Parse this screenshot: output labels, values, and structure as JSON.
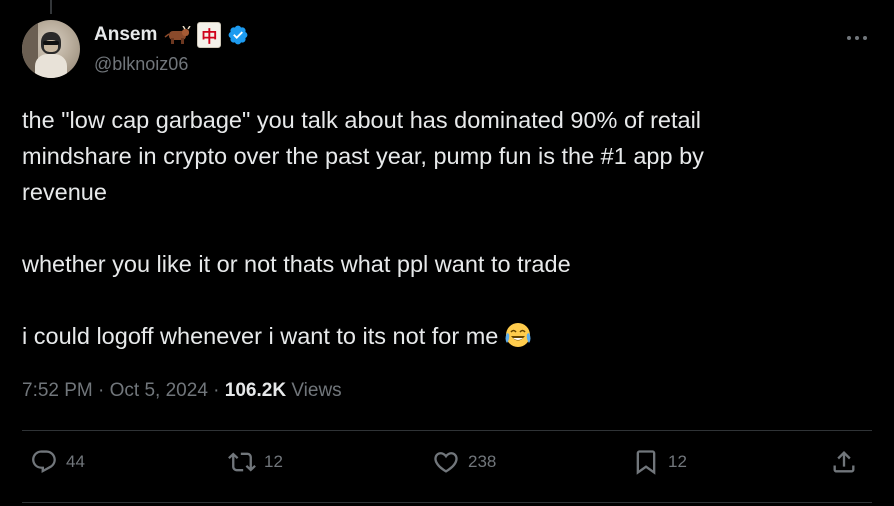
{
  "author": {
    "display_name": "Ansem",
    "handle": "@blknoiz06",
    "name_emojis": [
      "ox-emoji",
      "mahjong-red-dragon"
    ],
    "mahjong_glyph": "中",
    "verified": true
  },
  "tweet": {
    "text_line_1": "the \"low cap garbage\" you talk about has dominated 90% of retail",
    "text_line_2": "mindshare in crypto over the past year, pump fun is the #1 app by",
    "text_line_3": "revenue",
    "text_line_4": "whether you like it or not thats what ppl want to trade",
    "text_line_5": "i could logoff whenever i want to its not for me"
  },
  "meta": {
    "time": "7:52 PM",
    "separator": " · ",
    "date": "Oct 5, 2024",
    "views_count": "106.2K",
    "views_label": " Views"
  },
  "actions": {
    "replies": "44",
    "reposts": "12",
    "likes": "238",
    "bookmarks": "12"
  },
  "colors": {
    "background": "#000000",
    "text_primary": "#e7e9ea",
    "text_secondary": "#71767b",
    "verified_blue": "#1d9bf0",
    "divider": "#2f3336"
  }
}
